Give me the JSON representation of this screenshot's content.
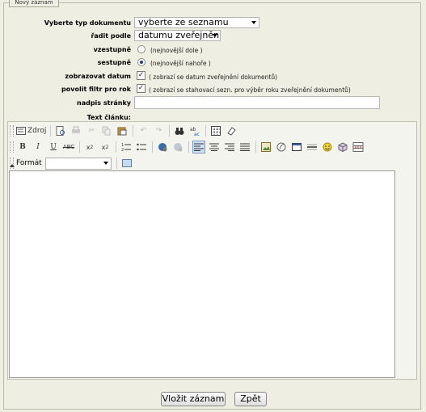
{
  "legend": "Nový záznam",
  "form": {
    "doc_type_label": "Vyberte typ dokumentu",
    "doc_type_value": "vyberte ze seznamu",
    "sort_label": "řadit podle",
    "sort_value": "datumu zveřejnění",
    "asc_label": "vzestupně",
    "asc_hint": "(nejnovější dole )",
    "desc_label": "sestupně",
    "desc_hint": "(nejnovější nahoře )",
    "show_date_label": "zobrazovat datum",
    "show_date_hint": "( zobrazí se datum zveřejnění dokumentů)",
    "year_filter_label": "povolit filtr pro rok",
    "year_filter_hint": "( zobrazí se stahovací sezn. pro výběr roku zveřejnění dokumentů)",
    "page_title_label": "nadpis stránky",
    "page_title_value": "",
    "article_label": "Text článku:"
  },
  "toolbar": {
    "source": "Zdroj",
    "format_label": "Formát",
    "format_value": ""
  },
  "buttons": {
    "submit": "Vložit záznam",
    "back": "Zpět"
  }
}
